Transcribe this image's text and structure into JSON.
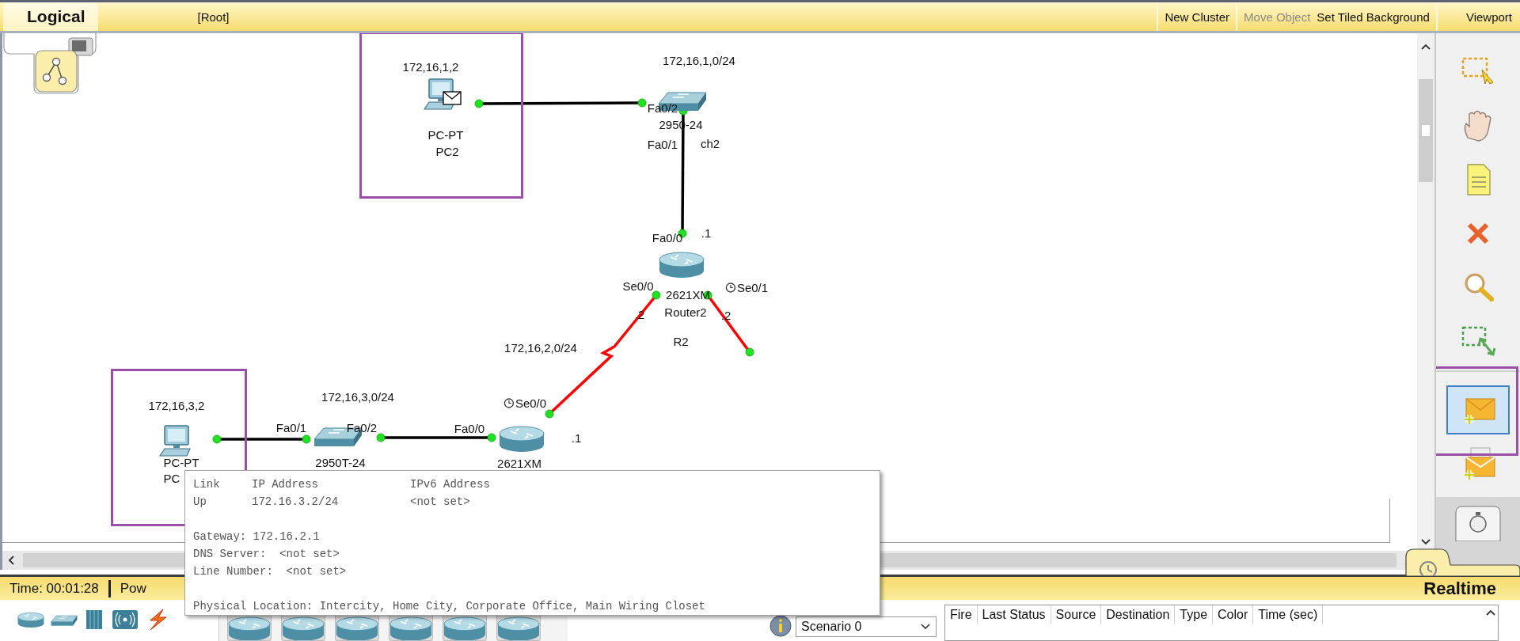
{
  "top_bar": {
    "tab": "Logical",
    "path": "[Root]",
    "buttons": [
      {
        "label": "New Cluster",
        "disabled": false
      },
      {
        "label": "Move Object",
        "disabled": true
      },
      {
        "label": "Set Tiled Background",
        "disabled": false
      },
      {
        "label": "Viewport",
        "disabled": false
      }
    ]
  },
  "devices": [
    {
      "kind": "pc",
      "model": "PC-PT",
      "name": "PC2",
      "pdu": true
    },
    {
      "kind": "switch",
      "model": "2950-24",
      "name": "ch2",
      "pdu": false
    },
    {
      "kind": "router",
      "model": "2621XM",
      "name": "Router2",
      "pdu": false
    },
    {
      "kind": "pc",
      "model": "PC-PT",
      "name": "PC",
      "pdu": false
    },
    {
      "kind": "switch",
      "model": "2950T-24",
      "pdu": false
    },
    {
      "kind": "router",
      "model": "2621XM",
      "pdu": false
    }
  ],
  "links": [
    {
      "kind": "copper"
    },
    {
      "kind": "copper"
    },
    {
      "kind": "serial"
    },
    {
      "kind": "serial"
    },
    {
      "kind": "copper"
    },
    {
      "kind": "copper"
    }
  ],
  "labels": [
    {
      "text": "172,16,1,2",
      "clock": false
    },
    {
      "text": "172,16,1,0/24",
      "clock": false
    },
    {
      "text": "Fa0/2",
      "clock": false
    },
    {
      "text": "Fa0/1",
      "clock": false
    },
    {
      "text": "Fa0/0",
      "clock": false
    },
    {
      "text": ".1",
      "clock": false
    },
    {
      "text": "Se0/0",
      "clock": false
    },
    {
      "text": "Se0/1",
      "clock": true
    },
    {
      "text": ".2",
      "clock": false
    },
    {
      "text": ".2",
      "clock": false
    },
    {
      "text": "R2",
      "clock": false
    },
    {
      "text": "172,16,2,0/24",
      "clock": false
    },
    {
      "text": "Se0/0",
      "clock": true
    },
    {
      "text": ".1",
      "clock": false
    },
    {
      "text": "Fa0/0",
      "clock": false
    },
    {
      "text": "172,16,3,0/24",
      "clock": false
    },
    {
      "text": "Fa0/1",
      "clock": false
    },
    {
      "text": "Fa0/2",
      "clock": false
    },
    {
      "text": "172,16,3,2",
      "clock": false
    }
  ],
  "tools": [
    {
      "kind": "select",
      "selected": false
    },
    {
      "kind": "move",
      "selected": false
    },
    {
      "kind": "note",
      "selected": false
    },
    {
      "kind": "delete",
      "selected": false
    },
    {
      "kind": "inspect",
      "selected": false
    },
    {
      "kind": "resize",
      "selected": false
    },
    {
      "kind": "simple-pdu",
      "selected": true
    },
    {
      "kind": "complex-pdu",
      "selected": false
    }
  ],
  "tooltip": {
    "headers": [
      "Link",
      "IP Address",
      "IPv6 Address"
    ],
    "values": [
      "Up",
      "172.16.3.2/24",
      "<not set>"
    ],
    "lines": [
      "Gateway: 172.16.2.1",
      "DNS Server:  <not set>",
      "Line Number:  <not set>"
    ],
    "location": "Physical Location: Intercity, Home City, Corporate Office, Main Wiring Closet"
  },
  "status_bar": {
    "time": "Time: 00:01:28",
    "power": "Pow",
    "mode": "Realtime"
  },
  "scenario": {
    "value": "Scenario 0"
  },
  "pdu_table": {
    "columns": [
      "Fire",
      "Last Status",
      "Source",
      "Destination",
      "Type",
      "Color",
      "Time (sec)"
    ]
  }
}
